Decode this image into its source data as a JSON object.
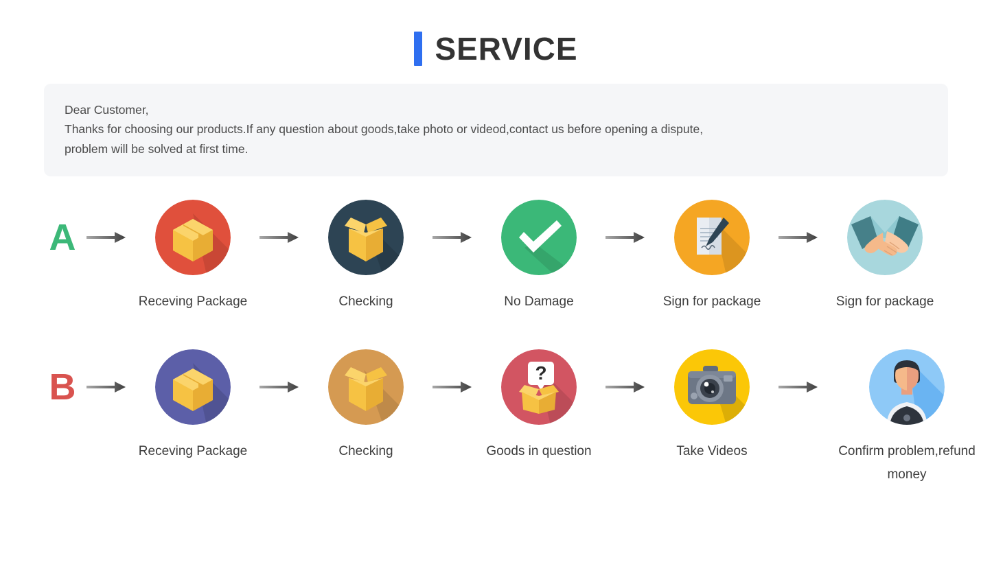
{
  "header": {
    "title": "SERVICE",
    "accent_color": "#2f6ff0"
  },
  "notice": {
    "greeting": "Dear Customer,",
    "line1": "Thanks for choosing our products.If any question about goods,take photo or videod,contact us before opening a dispute,",
    "line2": "problem will be solved at first time.",
    "background_color": "#f5f6f8"
  },
  "flows": [
    {
      "letter": "A",
      "letter_color": "#3cb878",
      "steps": [
        {
          "label": "Receving Package",
          "icon": "closed-box-icon",
          "circle_color": "#e0503c"
        },
        {
          "label": "Checking",
          "icon": "open-box-icon",
          "circle_color": "#2d4454"
        },
        {
          "label": "No Damage",
          "icon": "checkmark-icon",
          "circle_color": "#3bb878"
        },
        {
          "label": "Sign for package",
          "icon": "document-sign-icon",
          "circle_color": "#f5a623"
        },
        {
          "label": "Sign for package",
          "icon": "handshake-icon",
          "circle_color": "#a8d7dd"
        }
      ]
    },
    {
      "letter": "B",
      "letter_color": "#d9534f",
      "steps": [
        {
          "label": "Receving Package",
          "icon": "closed-box-icon",
          "circle_color": "#5c5fa8"
        },
        {
          "label": "Checking",
          "icon": "open-box-icon",
          "circle_color": "#d59a52"
        },
        {
          "label": "Goods in question",
          "icon": "question-box-icon",
          "circle_color": "#d25562"
        },
        {
          "label": "Take Videos",
          "icon": "camera-icon",
          "circle_color": "#fbc707"
        },
        {
          "label": "Confirm problem,refund money",
          "icon": "person-avatar-icon",
          "circle_color": "#8ec9f7"
        }
      ]
    }
  ],
  "arrow": {
    "name": "right-arrow-icon",
    "color": "#4a4a4a"
  }
}
